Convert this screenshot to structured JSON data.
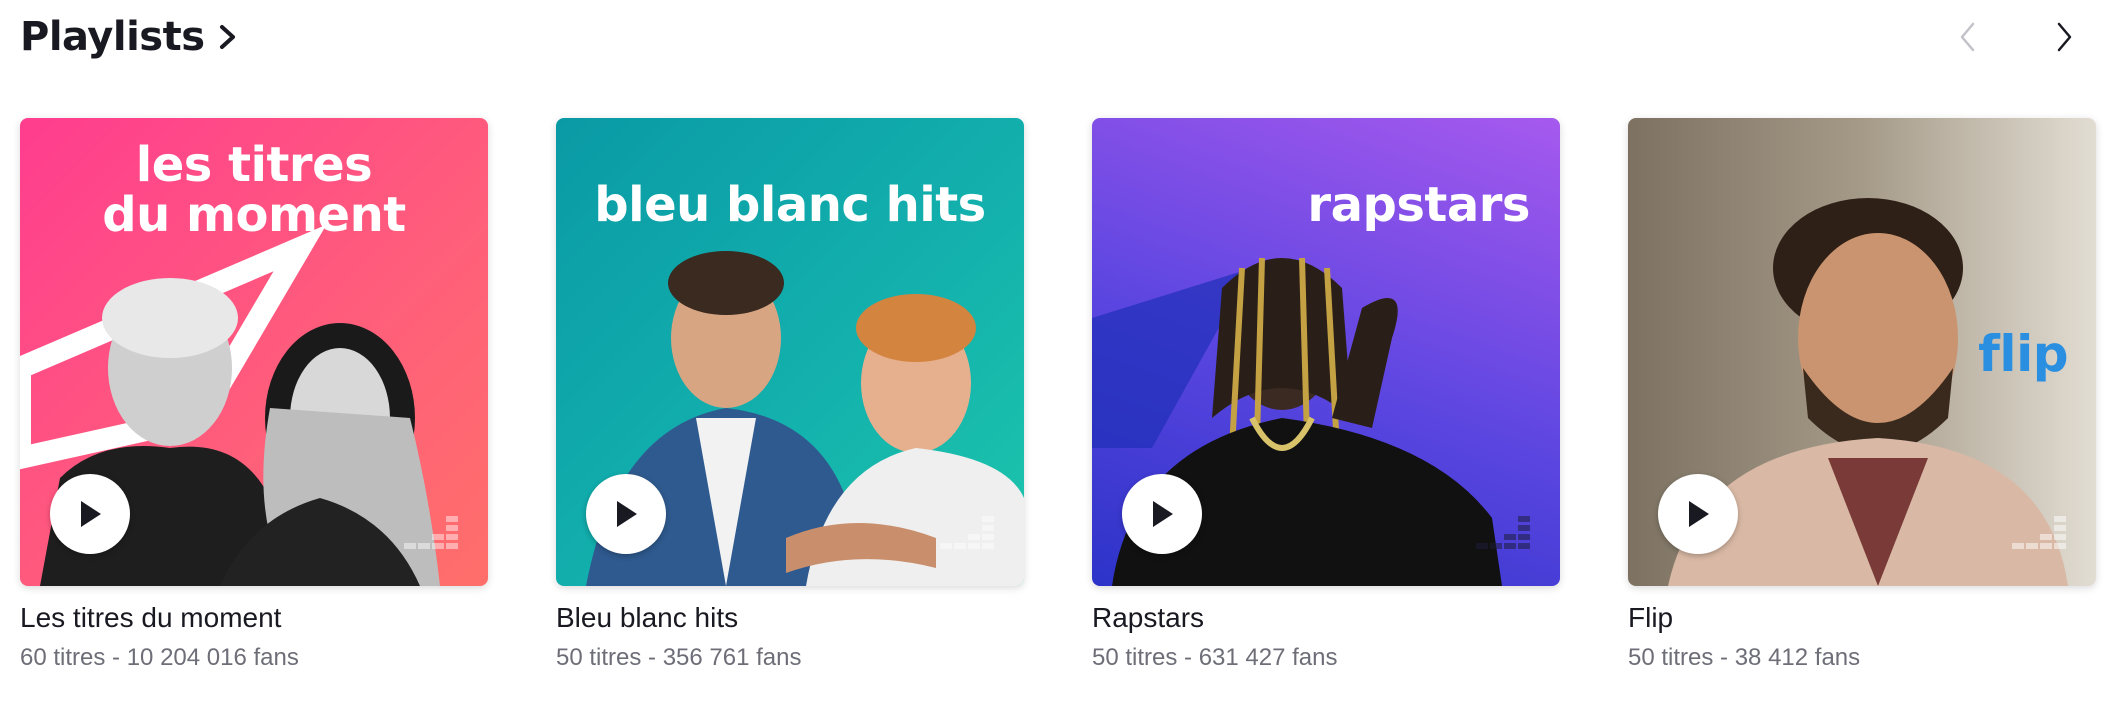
{
  "header": {
    "title": "Playlists"
  },
  "playlists": [
    {
      "cover_text": [
        "les titres",
        "du moment"
      ],
      "title": "Les titres du moment",
      "subtitle": "60 titres - 10 204 016 fans",
      "colors": {
        "from": "#ff4d8d",
        "to": "#ff6b6b"
      }
    },
    {
      "cover_text": [
        "bleu blanc hits"
      ],
      "title": "Bleu blanc hits",
      "subtitle": "50 titres - 356 761 fans",
      "colors": {
        "from": "#0fa3a8",
        "to": "#19c2b0"
      }
    },
    {
      "cover_text": [
        "rapstars"
      ],
      "title": "Rapstars",
      "subtitle": "50 titres - 631 427 fans",
      "colors": {
        "from": "#3d3ad6",
        "to": "#b15cf0"
      }
    },
    {
      "cover_text": [
        "flip"
      ],
      "title": "Flip",
      "subtitle": "50 titres - 38 412 fans",
      "colors": {
        "from": "#8a7b67",
        "to": "#d9d2c4"
      }
    }
  ]
}
